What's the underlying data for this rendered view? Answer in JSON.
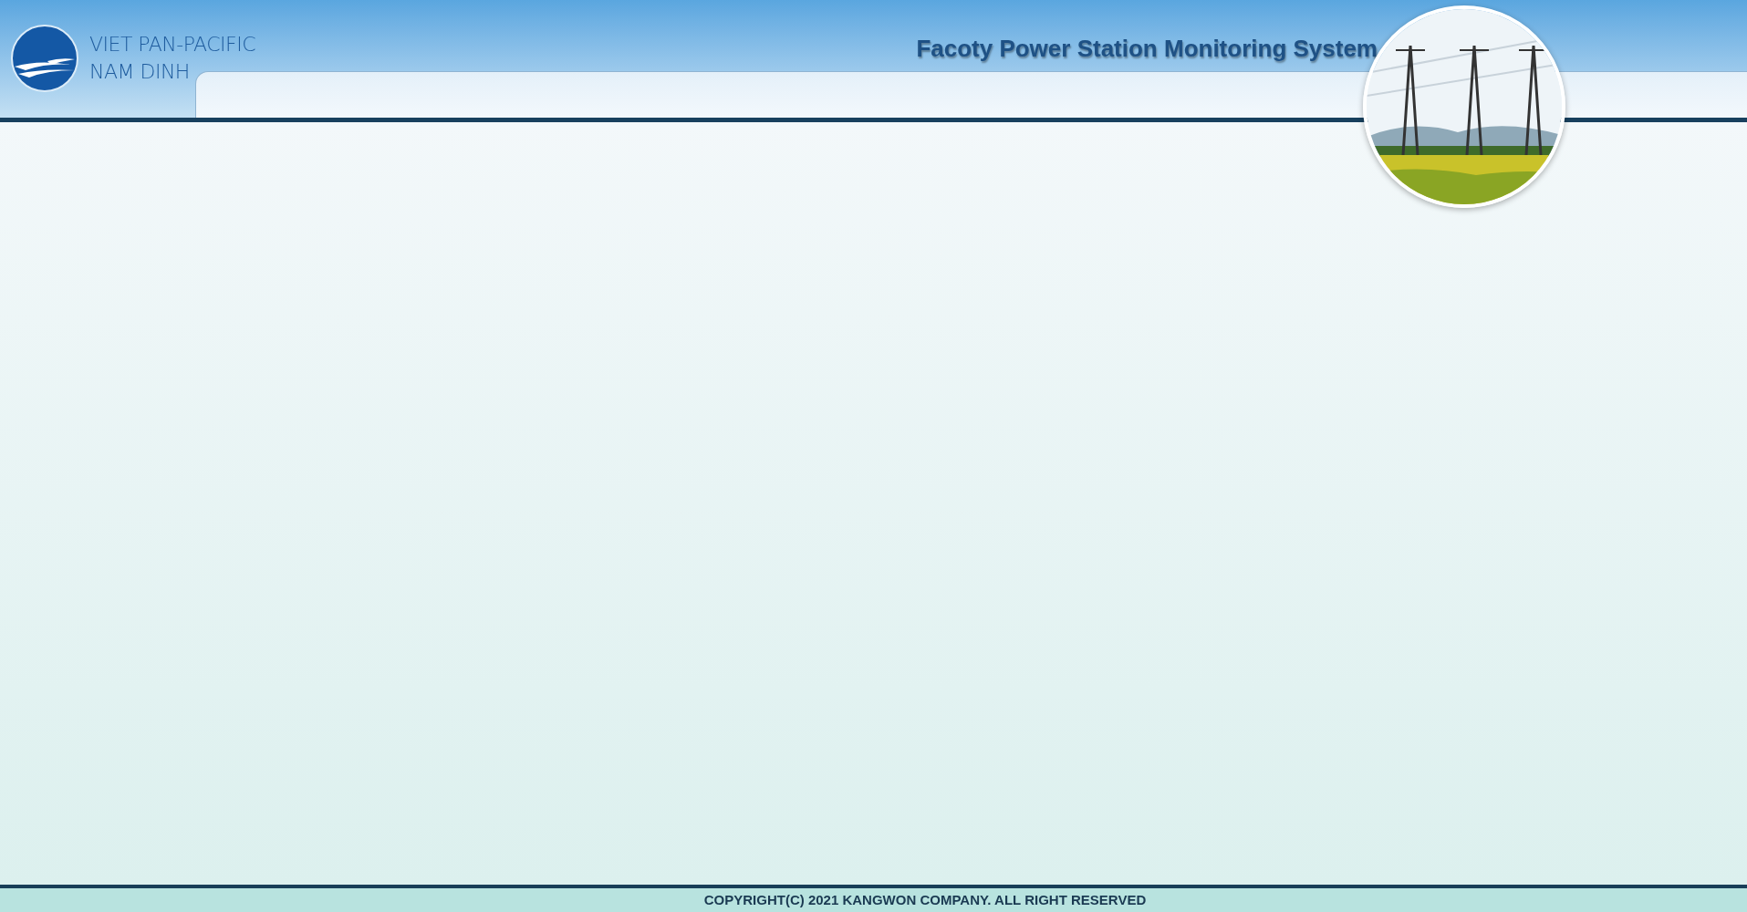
{
  "header": {
    "logo_lines": [
      "VIET PAN-PACIFIC",
      "NAM DINH"
    ],
    "title": "Facoty Power Station Monitoring System"
  },
  "footer": {
    "copyright": "COPYRIGHT(C) 2021 KANGWON COMPANY. ALL RIGHT RESERVED"
  }
}
